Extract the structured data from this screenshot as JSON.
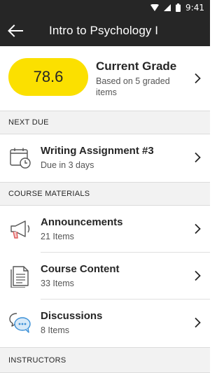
{
  "status_bar": {
    "time": "9:41",
    "icons": [
      "wifi-icon",
      "cellular-signal-icon",
      "battery-icon"
    ]
  },
  "app_bar": {
    "title": "Intro to Psychology I",
    "back_icon": "arrow-left-icon"
  },
  "grade": {
    "value": "78.6",
    "title": "Current Grade",
    "subtitle": "Based on 5 graded items",
    "pill_color": "#fbe000"
  },
  "next_due": {
    "header": "NEXT DUE",
    "items": [
      {
        "title": "Writing Assignment #3",
        "subtitle": "Due in 3 days",
        "icon": "calendar-clock-icon"
      }
    ]
  },
  "course_materials": {
    "header": "COURSE MATERIALS",
    "items": [
      {
        "title": "Announcements",
        "subtitle": "21 Items",
        "icon": "megaphone-icon"
      },
      {
        "title": "Course Content",
        "subtitle": "33 Items",
        "icon": "document-icon"
      },
      {
        "title": "Discussions",
        "subtitle": "8 Items",
        "icon": "chat-bubbles-icon"
      }
    ]
  },
  "instructors": {
    "header": "INSTRUCTORS"
  },
  "colors": {
    "app_bar": "#262626",
    "accent_yellow": "#fbe000",
    "section_bg": "#f2f2f2",
    "announcement_accent": "#e05a5a",
    "discussion_accent": "#3a8fd6"
  }
}
